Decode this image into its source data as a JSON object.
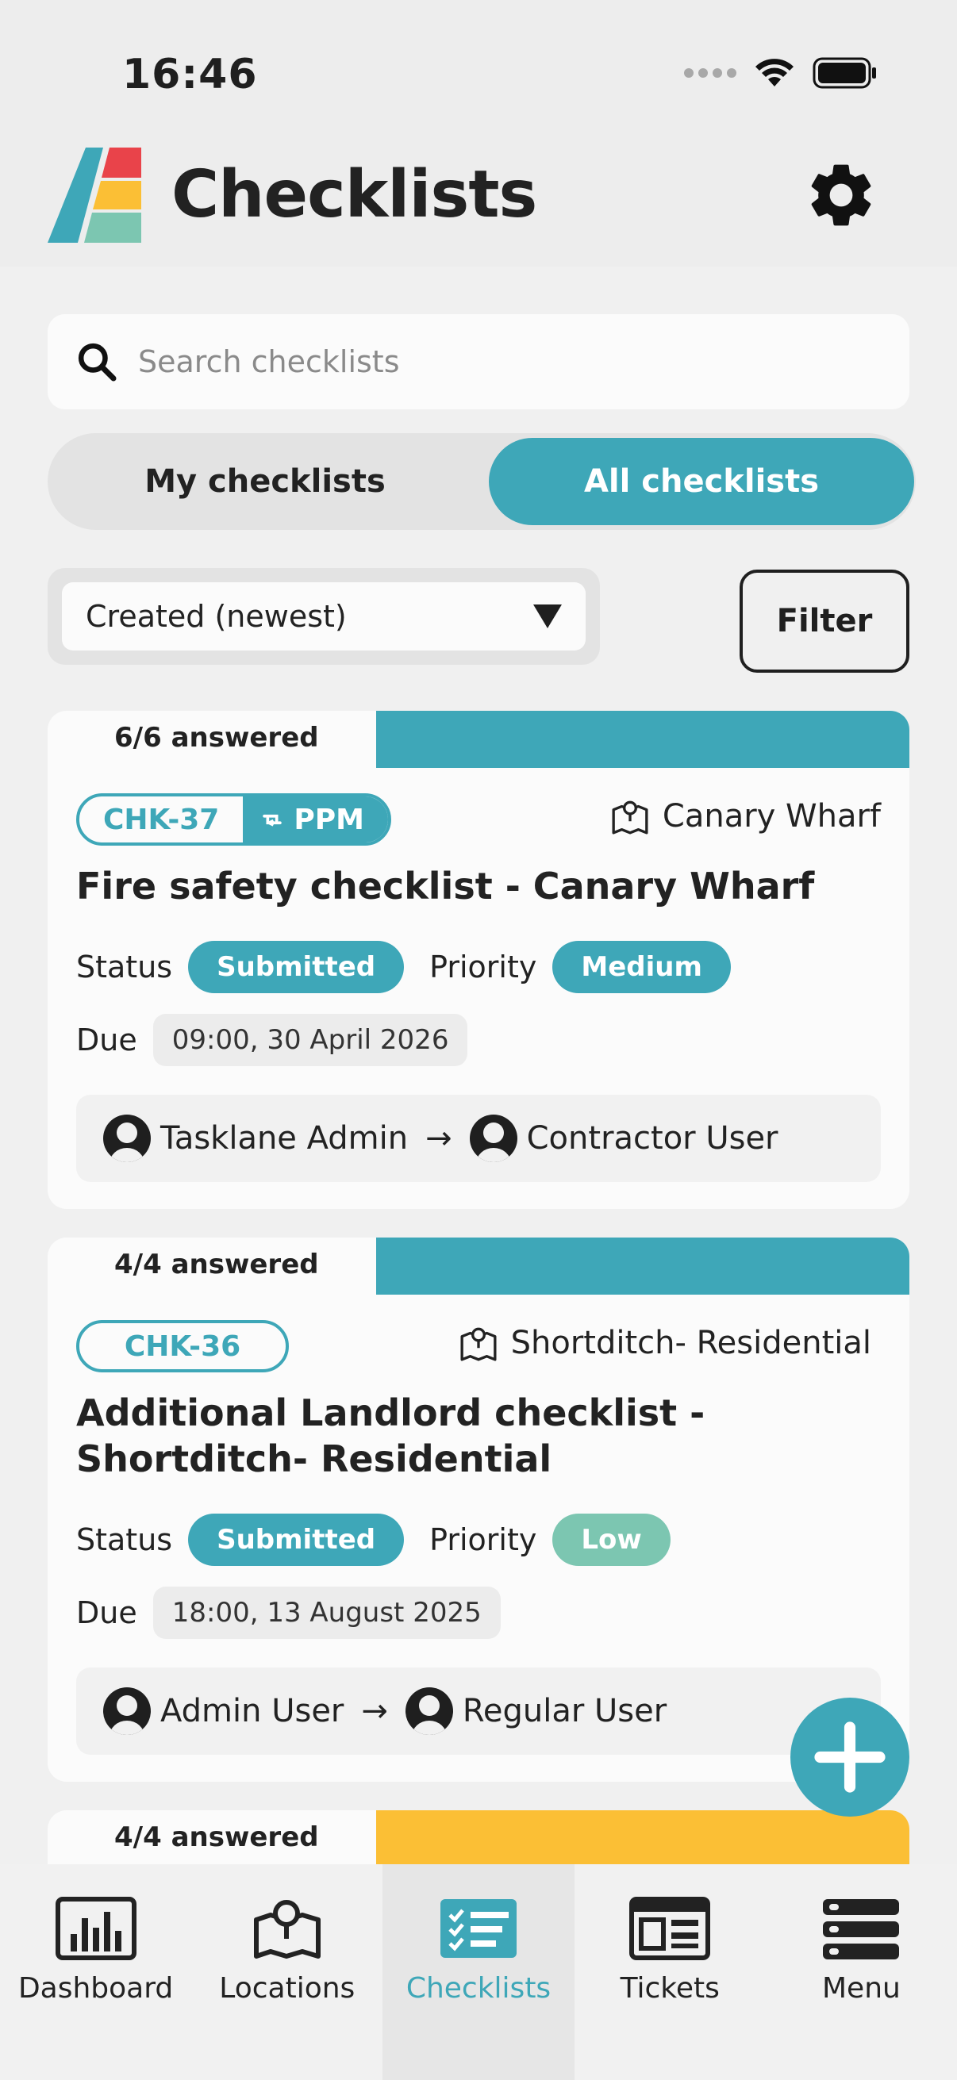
{
  "status_bar": {
    "time": "16:46"
  },
  "header": {
    "title": "Checklists"
  },
  "search": {
    "placeholder": "Search checklists"
  },
  "tabs": {
    "my": "My checklists",
    "all": "All checklists",
    "selected": "all"
  },
  "sort": {
    "selected": "Created (newest)"
  },
  "filter_label": "Filter",
  "colors": {
    "accent": "#3ea7b8",
    "low": "#7cc6b1",
    "warning": "#fbbf35"
  },
  "checklists": [
    {
      "answered": "6/6 answered",
      "progress_percent": 100,
      "id": "CHK-37",
      "tag": "PPM",
      "location": "Canary Wharf",
      "title": "Fire safety checklist  - Canary Wharf",
      "status_label": "Status",
      "status": "Submitted",
      "priority_label": "Priority",
      "priority": "Medium",
      "due_label": "Due",
      "due": "09:00, 30 April 2026",
      "from": "Tasklane Admin",
      "arrow": "→",
      "to": "Contractor User"
    },
    {
      "answered": "4/4 answered",
      "progress_percent": 100,
      "id": "CHK-36",
      "location": "Shortditch- Residential",
      "title": "Additional Landlord checklist  - Shortditch- Residential",
      "status_label": "Status",
      "status": "Submitted",
      "priority_label": "Priority",
      "priority": "Low",
      "due_label": "Due",
      "due": "18:00, 13 August 2025",
      "from": "Admin User",
      "arrow": "→",
      "to": "Regular User"
    },
    {
      "answered": "4/4 answered"
    }
  ],
  "nav": {
    "items": [
      {
        "label": "Dashboard",
        "icon": "bar-chart-icon"
      },
      {
        "label": "Locations",
        "icon": "map-pin-icon"
      },
      {
        "label": "Checklists",
        "icon": "checklist-icon",
        "active": true
      },
      {
        "label": "Tickets",
        "icon": "ticket-icon"
      },
      {
        "label": "Menu",
        "icon": "menu-icon"
      }
    ]
  }
}
